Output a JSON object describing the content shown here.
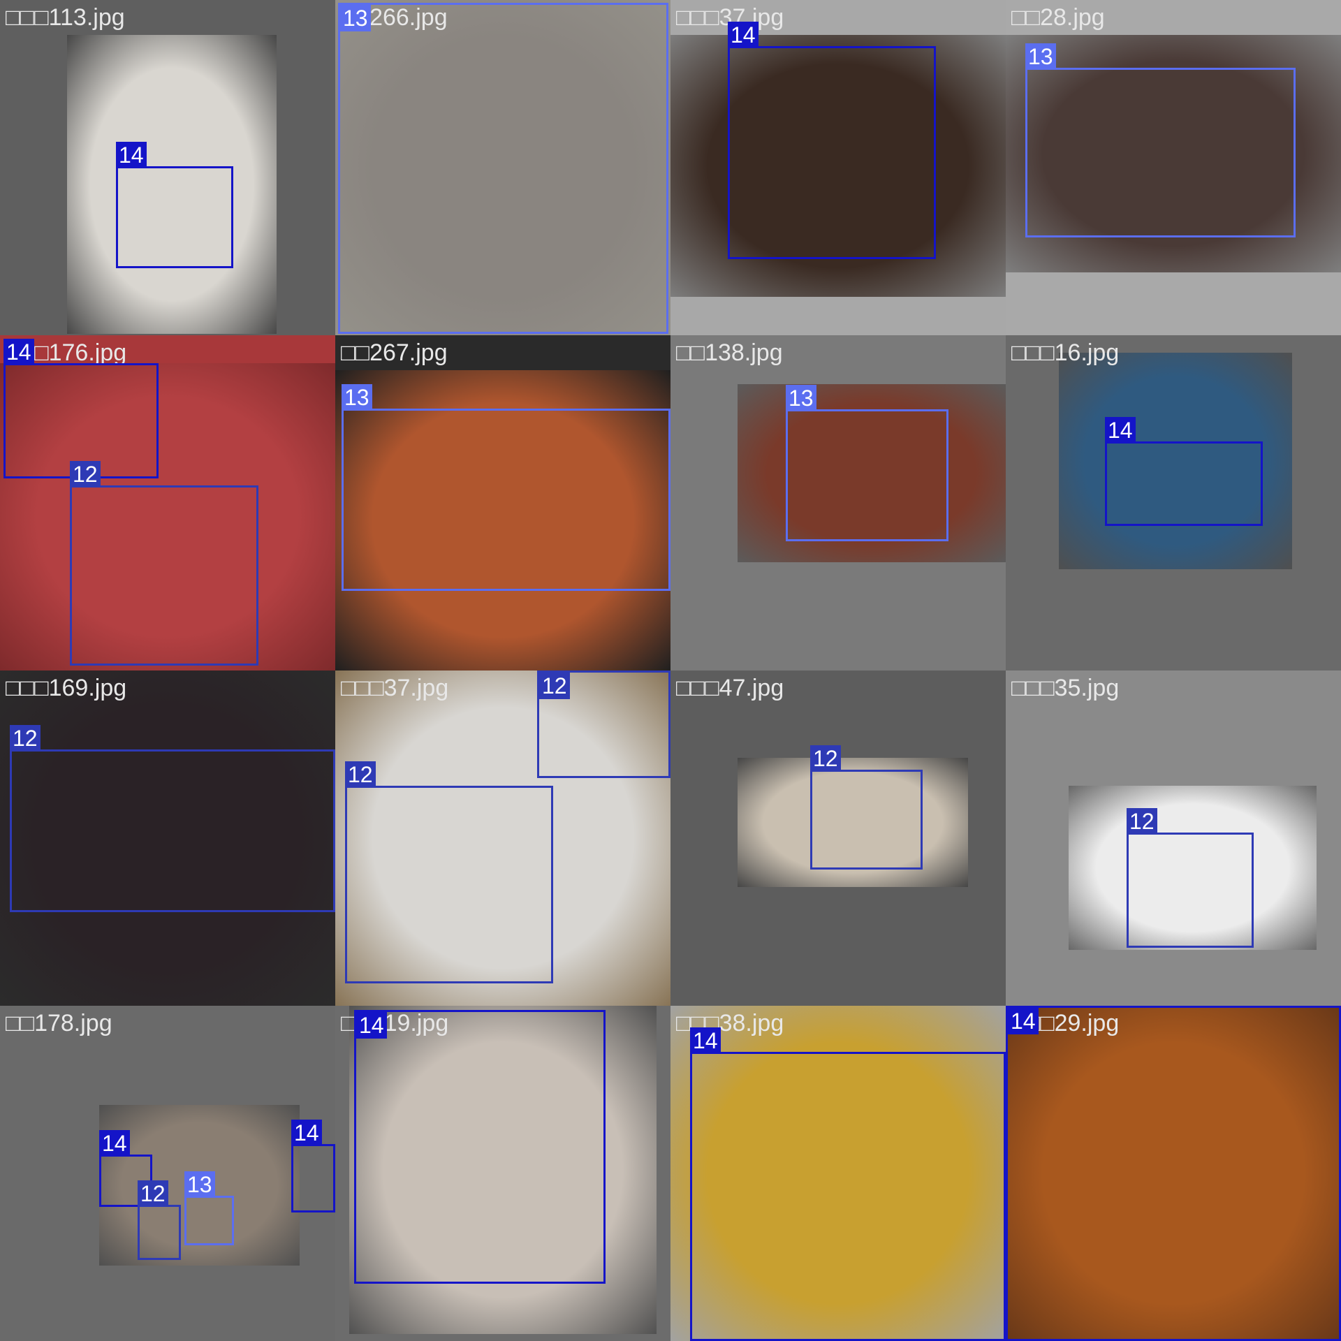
{
  "class_colors": {
    "12": "#2e3ab5",
    "13": "#5b6ef0",
    "14": "#1414c8"
  },
  "tiles": [
    {
      "filename": "□□□113.jpg",
      "bg": "#5f5f5f",
      "photo_bg": "#d9d6d0",
      "boxes": [
        {
          "cls": "14"
        }
      ]
    },
    {
      "filename": "□□266.jpg",
      "bg": "#c6c2b8",
      "photo_bg": "#8a8580",
      "boxes": [
        {
          "cls": "13"
        }
      ]
    },
    {
      "filename": "□□□37.jpg",
      "bg": "#a8a8a8",
      "photo_bg": "#3a2a22",
      "boxes": [
        {
          "cls": "14"
        }
      ]
    },
    {
      "filename": "□□28.jpg",
      "bg": "#a9a9a9",
      "photo_bg": "#4a3a36",
      "boxes": [
        {
          "cls": "13"
        }
      ]
    },
    {
      "filename": "□□□176.jpg",
      "bg": "#a8383a",
      "photo_bg": "#b34042",
      "boxes": [
        {
          "cls": "14"
        },
        {
          "cls": "12"
        }
      ]
    },
    {
      "filename": "□□267.jpg",
      "bg": "#2a2a2a",
      "photo_bg": "#b0562e",
      "boxes": [
        {
          "cls": "13"
        }
      ]
    },
    {
      "filename": "□□138.jpg",
      "bg": "#7a7a7a",
      "photo_bg": "#7a3a2a",
      "boxes": [
        {
          "cls": "13"
        }
      ]
    },
    {
      "filename": "□□□16.jpg",
      "bg": "#6a6a6a",
      "photo_bg": "#2f5a80",
      "boxes": [
        {
          "cls": "14"
        }
      ]
    },
    {
      "filename": "□□□169.jpg",
      "bg": "#3a3a3a",
      "photo_bg": "#2a2226",
      "boxes": [
        {
          "cls": "12"
        }
      ]
    },
    {
      "filename": "□□□37.jpg",
      "bg": "#b59a72",
      "photo_bg": "#d8d6d2",
      "boxes": [
        {
          "cls": "12"
        },
        {
          "cls": "12"
        }
      ]
    },
    {
      "filename": "□□□47.jpg",
      "bg": "#5d5d5d",
      "photo_bg": "#c9bfb0",
      "boxes": [
        {
          "cls": "12"
        }
      ]
    },
    {
      "filename": "□□□35.jpg",
      "bg": "#8a8a8a",
      "photo_bg": "#ececec",
      "boxes": [
        {
          "cls": "12"
        }
      ]
    },
    {
      "filename": "□□178.jpg",
      "bg": "#6a6a6a",
      "photo_bg": "#8a7e72",
      "boxes": [
        {
          "cls": "14"
        },
        {
          "cls": "14"
        },
        {
          "cls": "12"
        },
        {
          "cls": "13"
        }
      ]
    },
    {
      "filename": "□□□19.jpg",
      "bg": "#6c6c6c",
      "photo_bg": "#c8bfb6",
      "boxes": [
        {
          "cls": "14"
        }
      ]
    },
    {
      "filename": "□□□38.jpg",
      "bg": "#d8d8d8",
      "photo_bg": "#c8a030",
      "boxes": [
        {
          "cls": "14"
        }
      ]
    },
    {
      "filename": "□□□29.jpg",
      "bg": "#8a4a20",
      "photo_bg": "#a8581e",
      "boxes": [
        {
          "cls": "14"
        }
      ]
    }
  ]
}
